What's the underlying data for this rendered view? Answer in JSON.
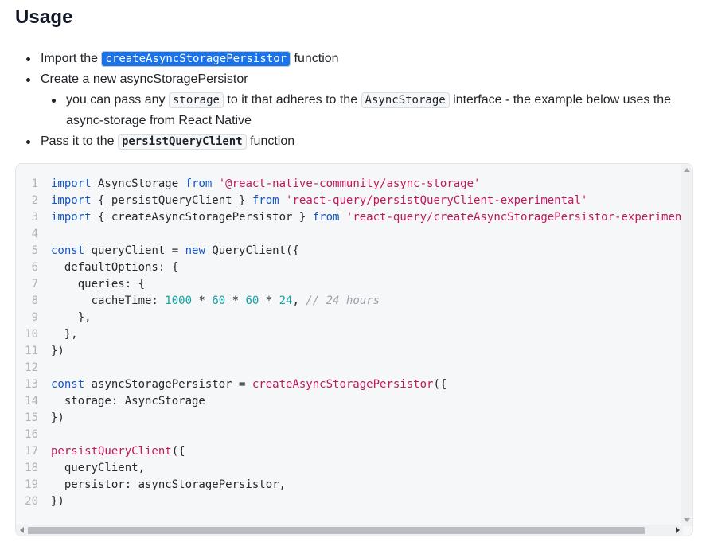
{
  "heading": "Usage",
  "bullets": {
    "b1": {
      "pre": "Import the ",
      "code": "createAsyncStoragePersistor",
      "post": " function"
    },
    "b2": {
      "text": "Create a new asyncStoragePersistor"
    },
    "b2sub": {
      "pre": "you can pass any ",
      "code1": "storage",
      "mid": " to it that adheres to the ",
      "code2": "AsyncStorage",
      "post": " interface - the example below uses the async-storage from React Native"
    },
    "b3": {
      "pre": "Pass it to the ",
      "code": "persistQueryClient",
      "post": " function"
    }
  },
  "code_lines": [
    [
      [
        "kw",
        "import"
      ],
      [
        "id",
        " AsyncStorage "
      ],
      [
        "kw",
        "from"
      ],
      [
        "id",
        " "
      ],
      [
        "str",
        "'@react-native-community/async-storage'"
      ]
    ],
    [
      [
        "kw",
        "import"
      ],
      [
        "id",
        " { persistQueryClient } "
      ],
      [
        "kw",
        "from"
      ],
      [
        "id",
        " "
      ],
      [
        "str",
        "'react-query/persistQueryClient-experimental'"
      ]
    ],
    [
      [
        "kw",
        "import"
      ],
      [
        "id",
        " { createAsyncStoragePersistor } "
      ],
      [
        "kw",
        "from"
      ],
      [
        "id",
        " "
      ],
      [
        "str",
        "'react-query/createAsyncStoragePersistor-experimental'"
      ]
    ],
    [],
    [
      [
        "kw",
        "const"
      ],
      [
        "id",
        " queryClient = "
      ],
      [
        "kw",
        "new"
      ],
      [
        "id",
        " QueryClient({"
      ]
    ],
    [
      [
        "id",
        "  defaultOptions: {"
      ]
    ],
    [
      [
        "id",
        "    queries: {"
      ]
    ],
    [
      [
        "id",
        "      cacheTime: "
      ],
      [
        "num",
        "1000"
      ],
      [
        "id",
        " * "
      ],
      [
        "num",
        "60"
      ],
      [
        "id",
        " * "
      ],
      [
        "num",
        "60"
      ],
      [
        "id",
        " * "
      ],
      [
        "num",
        "24"
      ],
      [
        "id",
        ", "
      ],
      [
        "com",
        "// 24 hours"
      ]
    ],
    [
      [
        "id",
        "    },"
      ]
    ],
    [
      [
        "id",
        "  },"
      ]
    ],
    [
      [
        "id",
        "})"
      ]
    ],
    [],
    [
      [
        "kw",
        "const"
      ],
      [
        "id",
        " asyncStoragePersistor = "
      ],
      [
        "fn",
        "createAsyncStoragePersistor"
      ],
      [
        "id",
        "({"
      ]
    ],
    [
      [
        "id",
        "  storage: AsyncStorage"
      ]
    ],
    [
      [
        "id",
        "})"
      ]
    ],
    [],
    [
      [
        "fn",
        "persistQueryClient"
      ],
      [
        "id",
        "({"
      ]
    ],
    [
      [
        "id",
        "  queryClient,"
      ]
    ],
    [
      [
        "id",
        "  persistor: asyncStoragePersistor,"
      ]
    ],
    [
      [
        "id",
        "})"
      ]
    ]
  ],
  "colors": {
    "keyword": "#1458c5",
    "string": "#c0185a",
    "number": "#13a3a3",
    "comment": "#9aa1a9",
    "selection": "#1a73e8"
  }
}
